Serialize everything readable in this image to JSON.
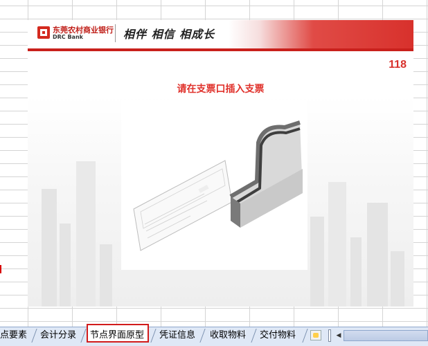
{
  "slide": {
    "bank_name_cn": "东莞农村商业银行",
    "bank_name_en": "DRC Bank",
    "slogan": "相伴 相信 相成长",
    "page_number": "118",
    "instruction": "请在支票口插入支票"
  },
  "tabs": [
    {
      "label": "点要素",
      "active": false
    },
    {
      "label": "会计分录",
      "active": false
    },
    {
      "label": "节点界面原型",
      "active": true
    },
    {
      "label": "凭证信息",
      "active": false
    },
    {
      "label": "收取物料",
      "active": false
    },
    {
      "label": "交付物料",
      "active": false
    }
  ],
  "colors": {
    "brand_red": "#d8312c",
    "active_tab_border": "#d21b1b"
  }
}
